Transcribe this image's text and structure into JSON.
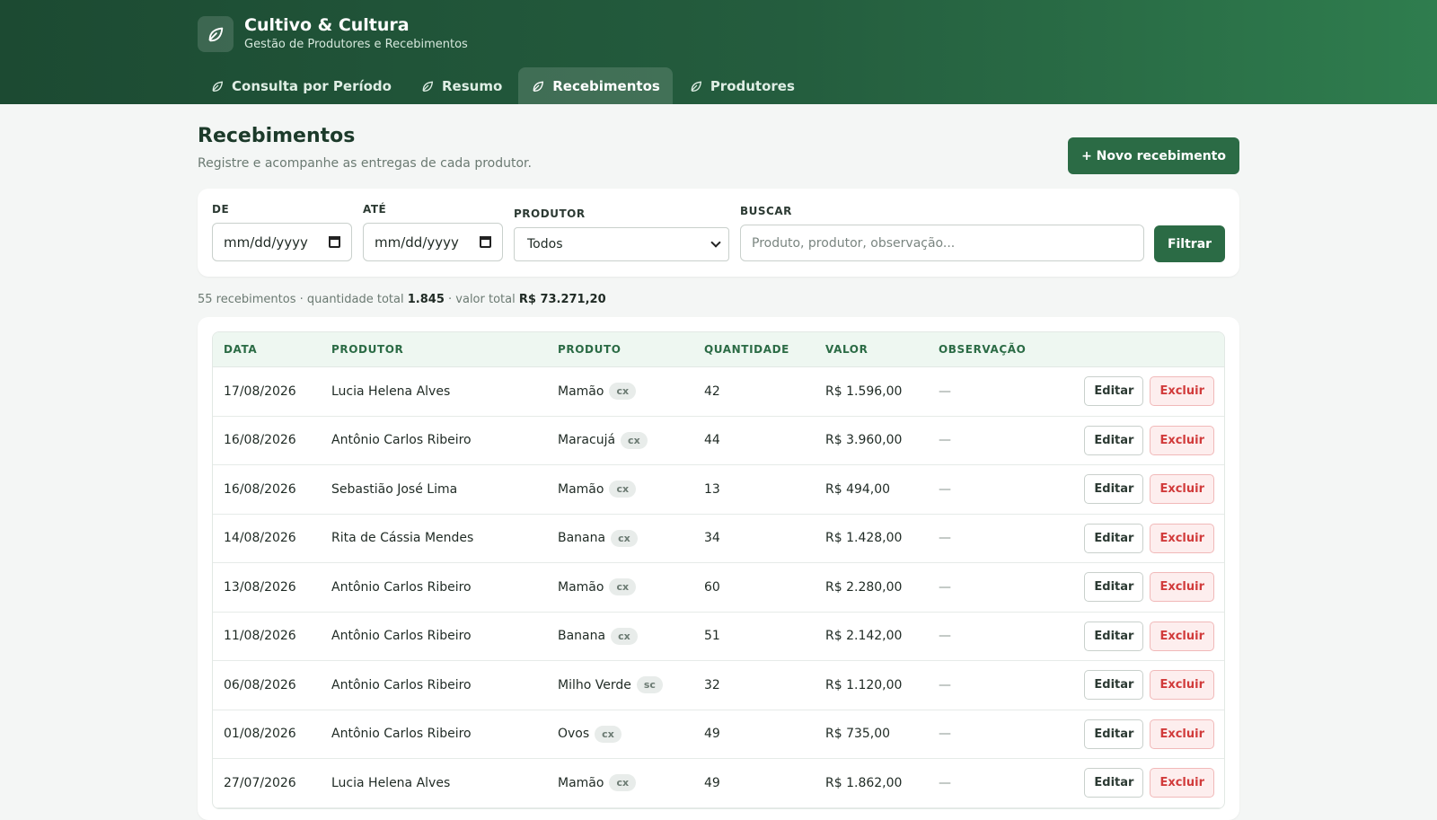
{
  "brand": {
    "title": "Cultivo & Cultura",
    "subtitle": "Gestão de Produtores e Recebimentos",
    "logo_icon": "leaf-icon"
  },
  "tabs": [
    {
      "label": "Consulta por Período",
      "icon": "leaf-icon",
      "active": false
    },
    {
      "label": "Resumo",
      "icon": "leaf-icon",
      "active": false
    },
    {
      "label": "Recebimentos",
      "icon": "leaf-icon",
      "active": true
    },
    {
      "label": "Produtores",
      "icon": "leaf-icon",
      "active": false
    }
  ],
  "page": {
    "title": "Recebimentos",
    "subtitle": "Registre e acompanhe as entregas de cada produtor.",
    "new_button": "+ Novo recebimento"
  },
  "filters": {
    "de_label": "DE",
    "de_value": "mm/dd/yyyy",
    "ate_label": "ATÉ",
    "ate_value": "mm/dd/yyyy",
    "produtor_label": "PRODUTOR",
    "produtor_value": "Todos",
    "buscar_label": "BUSCAR",
    "buscar_placeholder": "Produto, produtor, observação...",
    "filter_button": "Filtrar"
  },
  "summary": {
    "count_text": "55 recebimentos · quantidade total",
    "quantity_total": "1.845",
    "value_text": "· valor total",
    "value_total": "R$ 73.271,20"
  },
  "table": {
    "headers": [
      "DATA",
      "PRODUTOR",
      "PRODUTO",
      "QUANTIDADE",
      "VALOR",
      "OBSERVAÇÃO"
    ],
    "edit_label": "Editar",
    "delete_label": "Excluir",
    "rows": [
      {
        "data": "17/08/2026",
        "produtor": "Lucia Helena Alves",
        "produto": "Mamão",
        "unidade": "cx",
        "quantidade": "42",
        "valor": "R$ 1.596,00",
        "observacao": "—"
      },
      {
        "data": "16/08/2026",
        "produtor": "Antônio Carlos Ribeiro",
        "produto": "Maracujá",
        "unidade": "cx",
        "quantidade": "44",
        "valor": "R$ 3.960,00",
        "observacao": "—"
      },
      {
        "data": "16/08/2026",
        "produtor": "Sebastião José Lima",
        "produto": "Mamão",
        "unidade": "cx",
        "quantidade": "13",
        "valor": "R$ 494,00",
        "observacao": "—"
      },
      {
        "data": "14/08/2026",
        "produtor": "Rita de Cássia Mendes",
        "produto": "Banana",
        "unidade": "cx",
        "quantidade": "34",
        "valor": "R$ 1.428,00",
        "observacao": "—"
      },
      {
        "data": "13/08/2026",
        "produtor": "Antônio Carlos Ribeiro",
        "produto": "Mamão",
        "unidade": "cx",
        "quantidade": "60",
        "valor": "R$ 2.280,00",
        "observacao": "—"
      },
      {
        "data": "11/08/2026",
        "produtor": "Antônio Carlos Ribeiro",
        "produto": "Banana",
        "unidade": "cx",
        "quantidade": "51",
        "valor": "R$ 2.142,00",
        "observacao": "—"
      },
      {
        "data": "06/08/2026",
        "produtor": "Antônio Carlos Ribeiro",
        "produto": "Milho Verde",
        "unidade": "sc",
        "quantidade": "32",
        "valor": "R$ 1.120,00",
        "observacao": "—"
      },
      {
        "data": "01/08/2026",
        "produtor": "Antônio Carlos Ribeiro",
        "produto": "Ovos",
        "unidade": "cx",
        "quantidade": "49",
        "valor": "R$ 735,00",
        "observacao": "—"
      },
      {
        "data": "27/07/2026",
        "produtor": "Lucia Helena Alves",
        "produto": "Mamão",
        "unidade": "cx",
        "quantidade": "49",
        "valor": "R$ 1.862,00",
        "observacao": "—"
      }
    ]
  }
}
